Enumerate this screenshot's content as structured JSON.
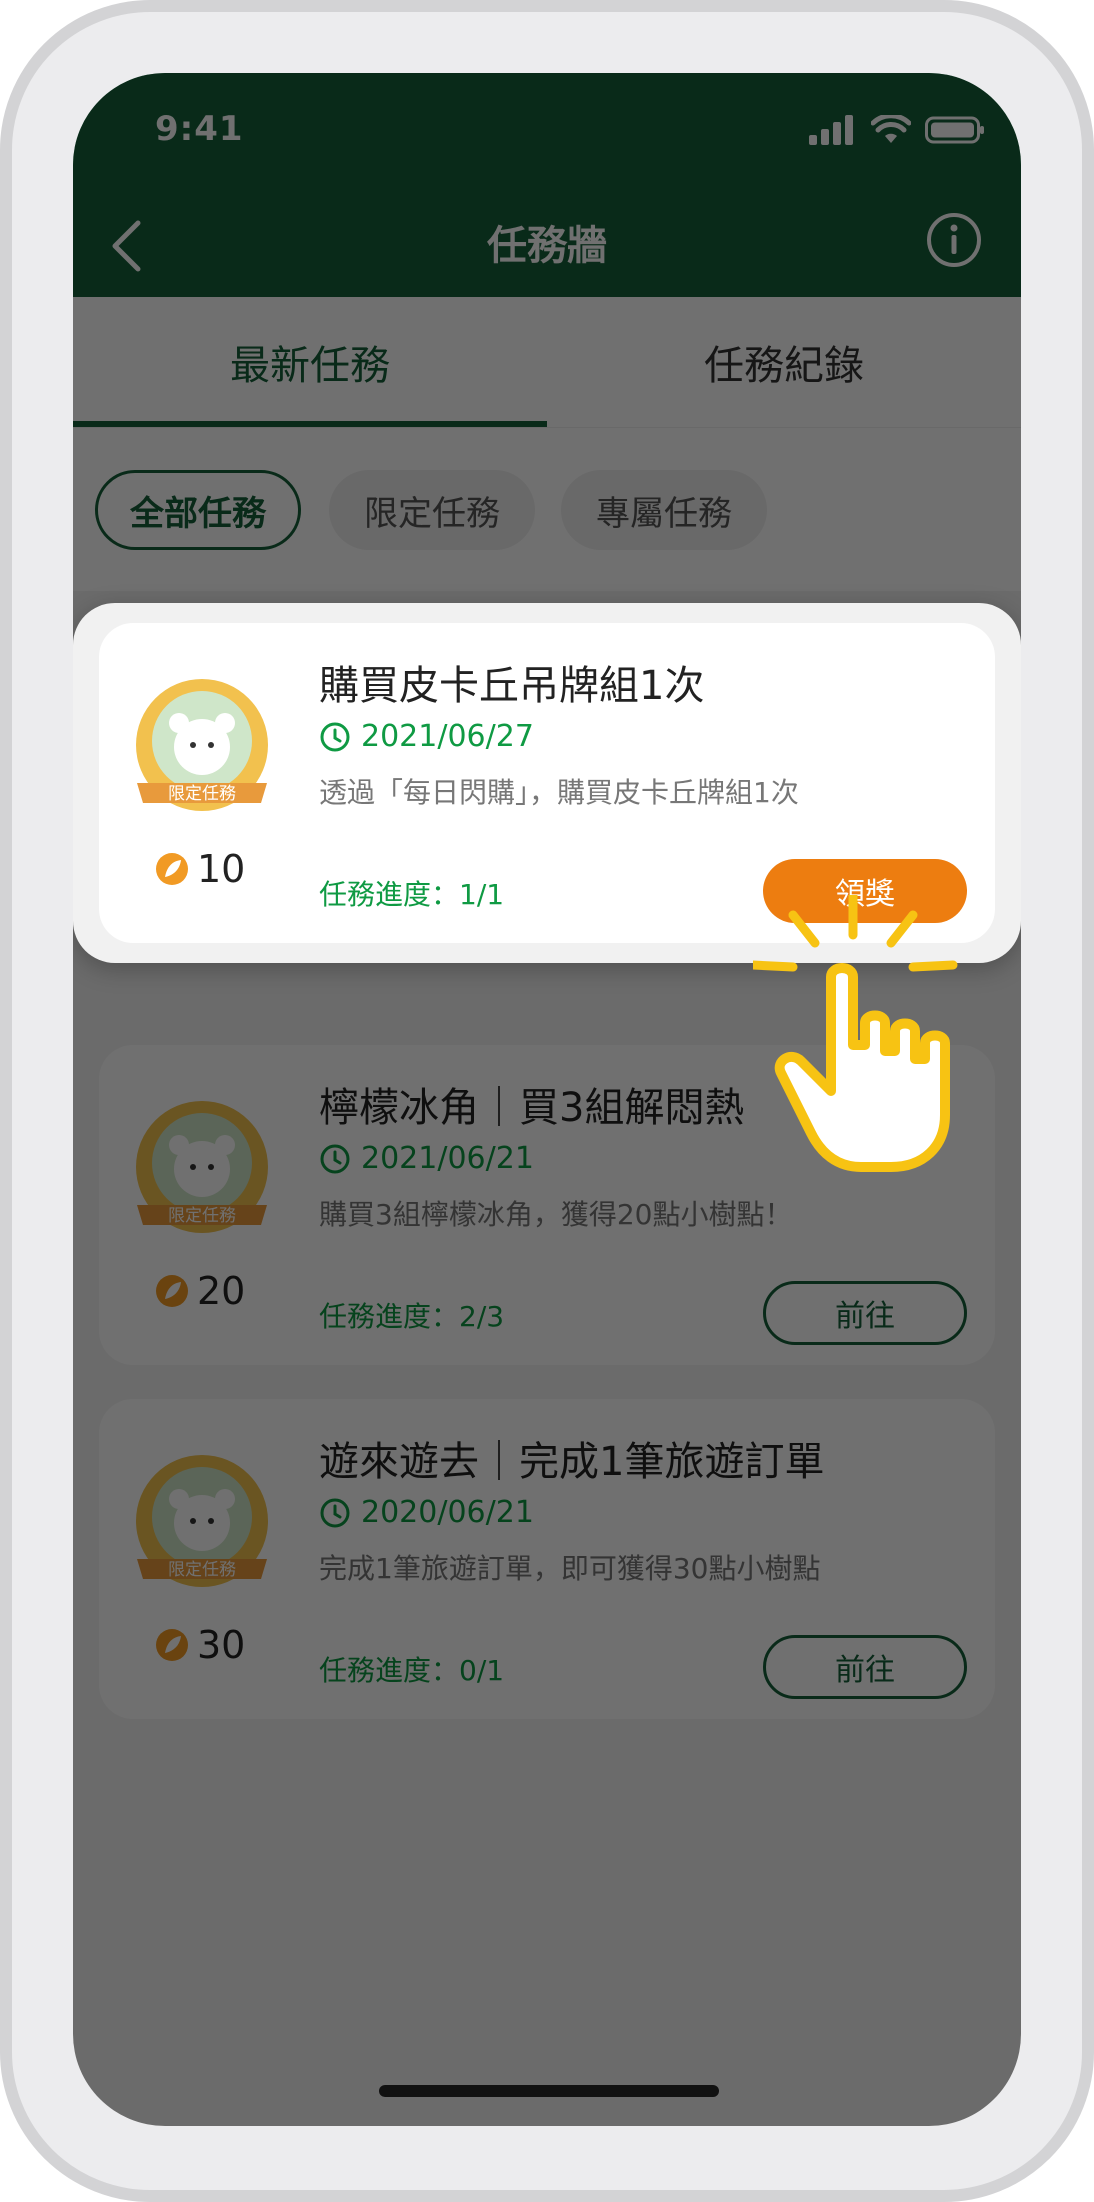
{
  "status_bar": {
    "time": "9:41"
  },
  "nav": {
    "title": "任務牆"
  },
  "tabs": [
    {
      "label": "最新任務",
      "active": true
    },
    {
      "label": "任務紀錄",
      "active": false
    }
  ],
  "filters": [
    {
      "label": "全部任務",
      "active": true
    },
    {
      "label": "限定任務",
      "active": false
    },
    {
      "label": "專屬任務",
      "active": false
    }
  ],
  "badge_label": "限定任務",
  "tasks": [
    {
      "title": "購買皮卡丘吊牌組1次",
      "date": "2021/06/27",
      "desc": "透過「每日閃購」，購買皮卡丘牌組1次",
      "points": "10",
      "progress": "任務進度：1/1",
      "button": "領獎",
      "highlighted": true
    },
    {
      "title": "檸檬冰角｜買3組解悶熱",
      "date": "2021/06/21",
      "desc": "購買3組檸檬冰角，獲得20點小樹點！",
      "points": "20",
      "progress": "任務進度：2/3",
      "button": "前往",
      "highlighted": false
    },
    {
      "title": "遊來遊去｜完成1筆旅遊訂單",
      "date": "2020/06/21",
      "desc": "完成1筆旅遊訂單，即可獲得30點小樹點",
      "points": "30",
      "progress": "任務進度：0/1",
      "button": "前往",
      "highlighted": false
    }
  ],
  "colors": {
    "primary": "#15613a",
    "accent_green": "#0f9a43",
    "claim_orange": "#ed7d10",
    "badge_gold": "#f2c14e"
  }
}
